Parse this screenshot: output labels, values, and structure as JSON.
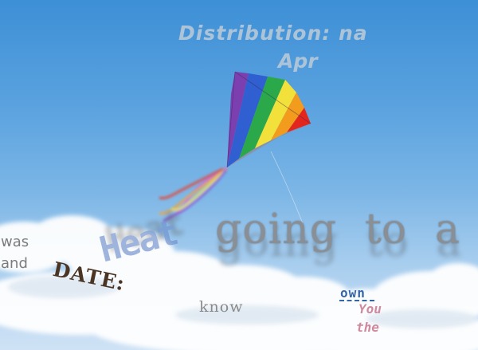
{
  "scene": {
    "description_colors": {
      "sky_top": "#3d8fd6",
      "sky_bottom": "#cfe2f5",
      "cloud": "#ffffff",
      "kite_stripes": [
        "#7b3fb0",
        "#2f5fd0",
        "#2aa84a",
        "#f2e13a",
        "#f29b1c",
        "#e2261e"
      ]
    },
    "overlay_text": {
      "distribution": "Distribution:  na",
      "apr": "Apr",
      "going": "going",
      "to": "to",
      "a": "a",
      "was": "was",
      "and": "and",
      "heat": "Heat",
      "date": "DATE:",
      "know": "know",
      "own": "own",
      "you": "You",
      "the": "the"
    }
  }
}
